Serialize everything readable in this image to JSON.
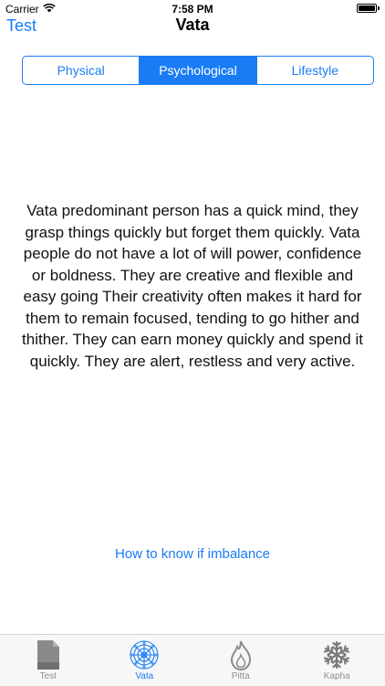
{
  "status": {
    "carrier": "Carrier",
    "time": "7:58 PM",
    "battery_level": 1.0
  },
  "nav": {
    "back_label": "Test",
    "title": "Vata"
  },
  "segments": [
    {
      "label": "Physical",
      "active": false
    },
    {
      "label": "Psychological",
      "active": true
    },
    {
      "label": "Lifestyle",
      "active": false
    }
  ],
  "content": {
    "text": "Vata predominant person has a quick mind, they grasp things quickly but forget them quickly. Vata people do not have a lot of will power, confidence or boldness. They are creative and flexible and easy going Their creativity often makes it hard for them to remain focused, tending to go hither and thither. They can earn money quickly and spend it quickly. They are alert, restless and very active.",
    "link": "How to know if imbalance"
  },
  "tabs": [
    {
      "label": "Test",
      "icon": "document-icon",
      "active": false
    },
    {
      "label": "Vata",
      "icon": "mandala-icon",
      "active": true
    },
    {
      "label": "Pitta",
      "icon": "flame-icon",
      "active": false
    },
    {
      "label": "Kapha",
      "icon": "snowflake-icon",
      "active": false
    }
  ],
  "colors": {
    "accent": "#1a7cf5",
    "tab_inactive": "#8e8e93"
  }
}
